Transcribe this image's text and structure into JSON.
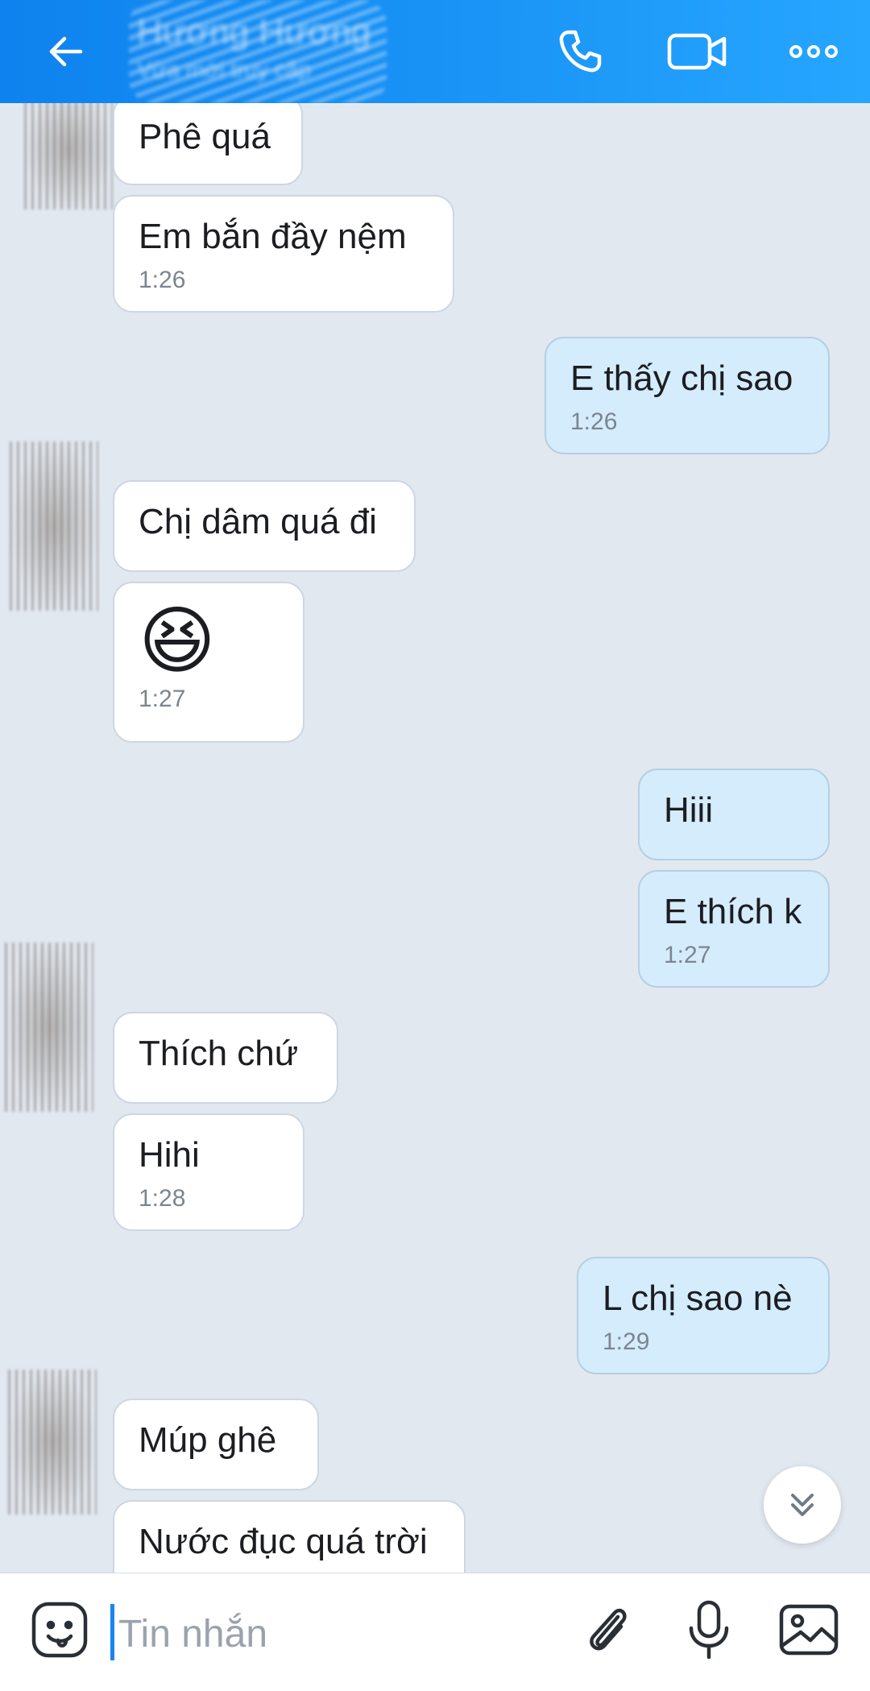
{
  "header": {
    "contact_name": "Hương Hương",
    "status": "Vừa mới truy cập",
    "back_icon": "arrow-left-icon",
    "call_icon": "phone-icon",
    "video_icon": "video-camera-icon",
    "more_icon": "more-dots-icon"
  },
  "messages": [
    {
      "text": "Phê quá"
    },
    {
      "text": "Em bắn đầy nệm",
      "time": "1:26"
    },
    {
      "text": "E thấy chị sao",
      "time": "1:26"
    },
    {
      "text": "Chị dâm quá đi"
    },
    {
      "emoji": "😆",
      "time": "1:27"
    },
    {
      "text": "Hiii"
    },
    {
      "text": "E thích k",
      "time": "1:27"
    },
    {
      "text": "Thích chứ"
    },
    {
      "text": "Hihi",
      "time": "1:28"
    },
    {
      "text": "L chị sao nè",
      "time": "1:29"
    },
    {
      "text": "Múp ghê"
    },
    {
      "text": "Nước đục quá trời"
    }
  ],
  "composer": {
    "placeholder": "Tin nhắn",
    "sticker_icon": "emoji-face-icon",
    "attach_icon": "paperclip-icon",
    "mic_icon": "microphone-icon",
    "image_icon": "image-icon"
  },
  "colors": {
    "header_accent": "#0e82ee",
    "outgoing_bubble": "#d5ecfc",
    "incoming_bubble": "#ffffff",
    "background": "#e2e8f0"
  }
}
